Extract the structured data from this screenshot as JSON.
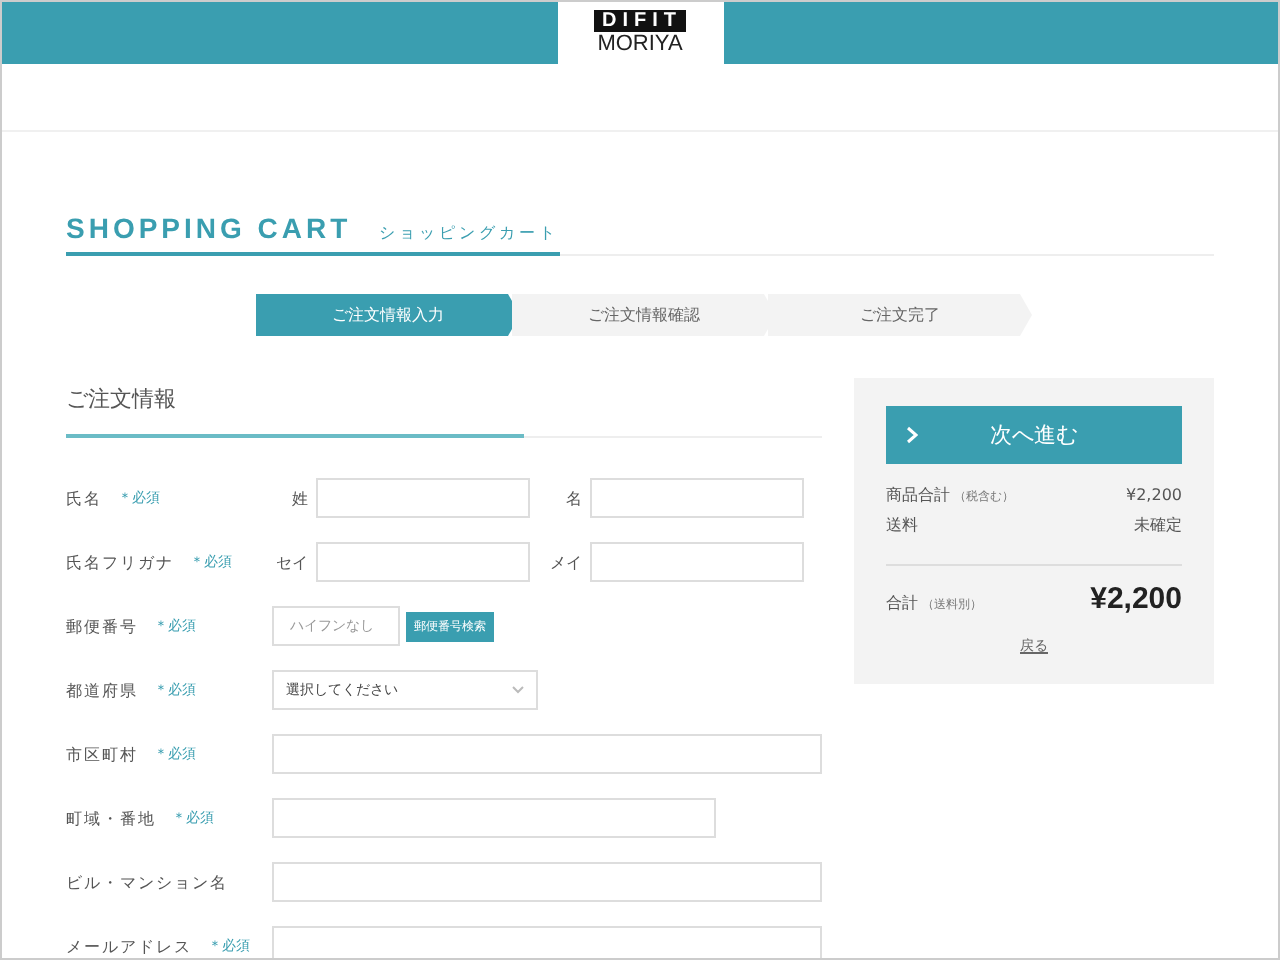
{
  "header": {
    "logo_top": "DIFIT",
    "logo_bottom": "MORIYA"
  },
  "page_title": {
    "title": "SHOPPING CART",
    "subtitle": "ショッピングカート"
  },
  "steps": [
    {
      "label": "ご注文情報入力",
      "selected": true
    },
    {
      "label": "ご注文情報確認",
      "selected": false
    },
    {
      "label": "ご注文完了",
      "selected": false
    }
  ],
  "form": {
    "title": "ご注文情報",
    "fields": [
      {
        "kind": "pair",
        "label": "氏名",
        "badge": "＊必須",
        "sub_labels": [
          "姓",
          "名"
        ]
      },
      {
        "kind": "pair",
        "label": "氏名フリガナ",
        "badge": "＊必須",
        "sub_labels": [
          "セイ",
          "メイ"
        ]
      },
      {
        "kind": "postal",
        "label": "郵便番号",
        "badge": "＊必須",
        "placeholder": "ハイフンなし",
        "button": "郵便番号検索"
      },
      {
        "kind": "select",
        "label": "都道府県",
        "badge": "＊必須",
        "value": "選択してください"
      },
      {
        "kind": "text",
        "label": "市区町村",
        "badge": "＊必須"
      },
      {
        "kind": "text_short",
        "label": "町域・番地",
        "badge": "＊必須"
      },
      {
        "kind": "text",
        "label": "ビル・マンション名"
      },
      {
        "kind": "text",
        "label": "メールアドレス",
        "badge": "＊必須"
      }
    ]
  },
  "summary": {
    "next_button": "次へ進む",
    "rows": [
      {
        "label": "商品合計",
        "note": "（税含む）",
        "value": "¥2,200"
      },
      {
        "label": "送料",
        "value": "未確定"
      }
    ],
    "total": {
      "label": "合計",
      "note": "（送料別）",
      "value": "¥2,200"
    },
    "back_link": "戻る"
  }
}
